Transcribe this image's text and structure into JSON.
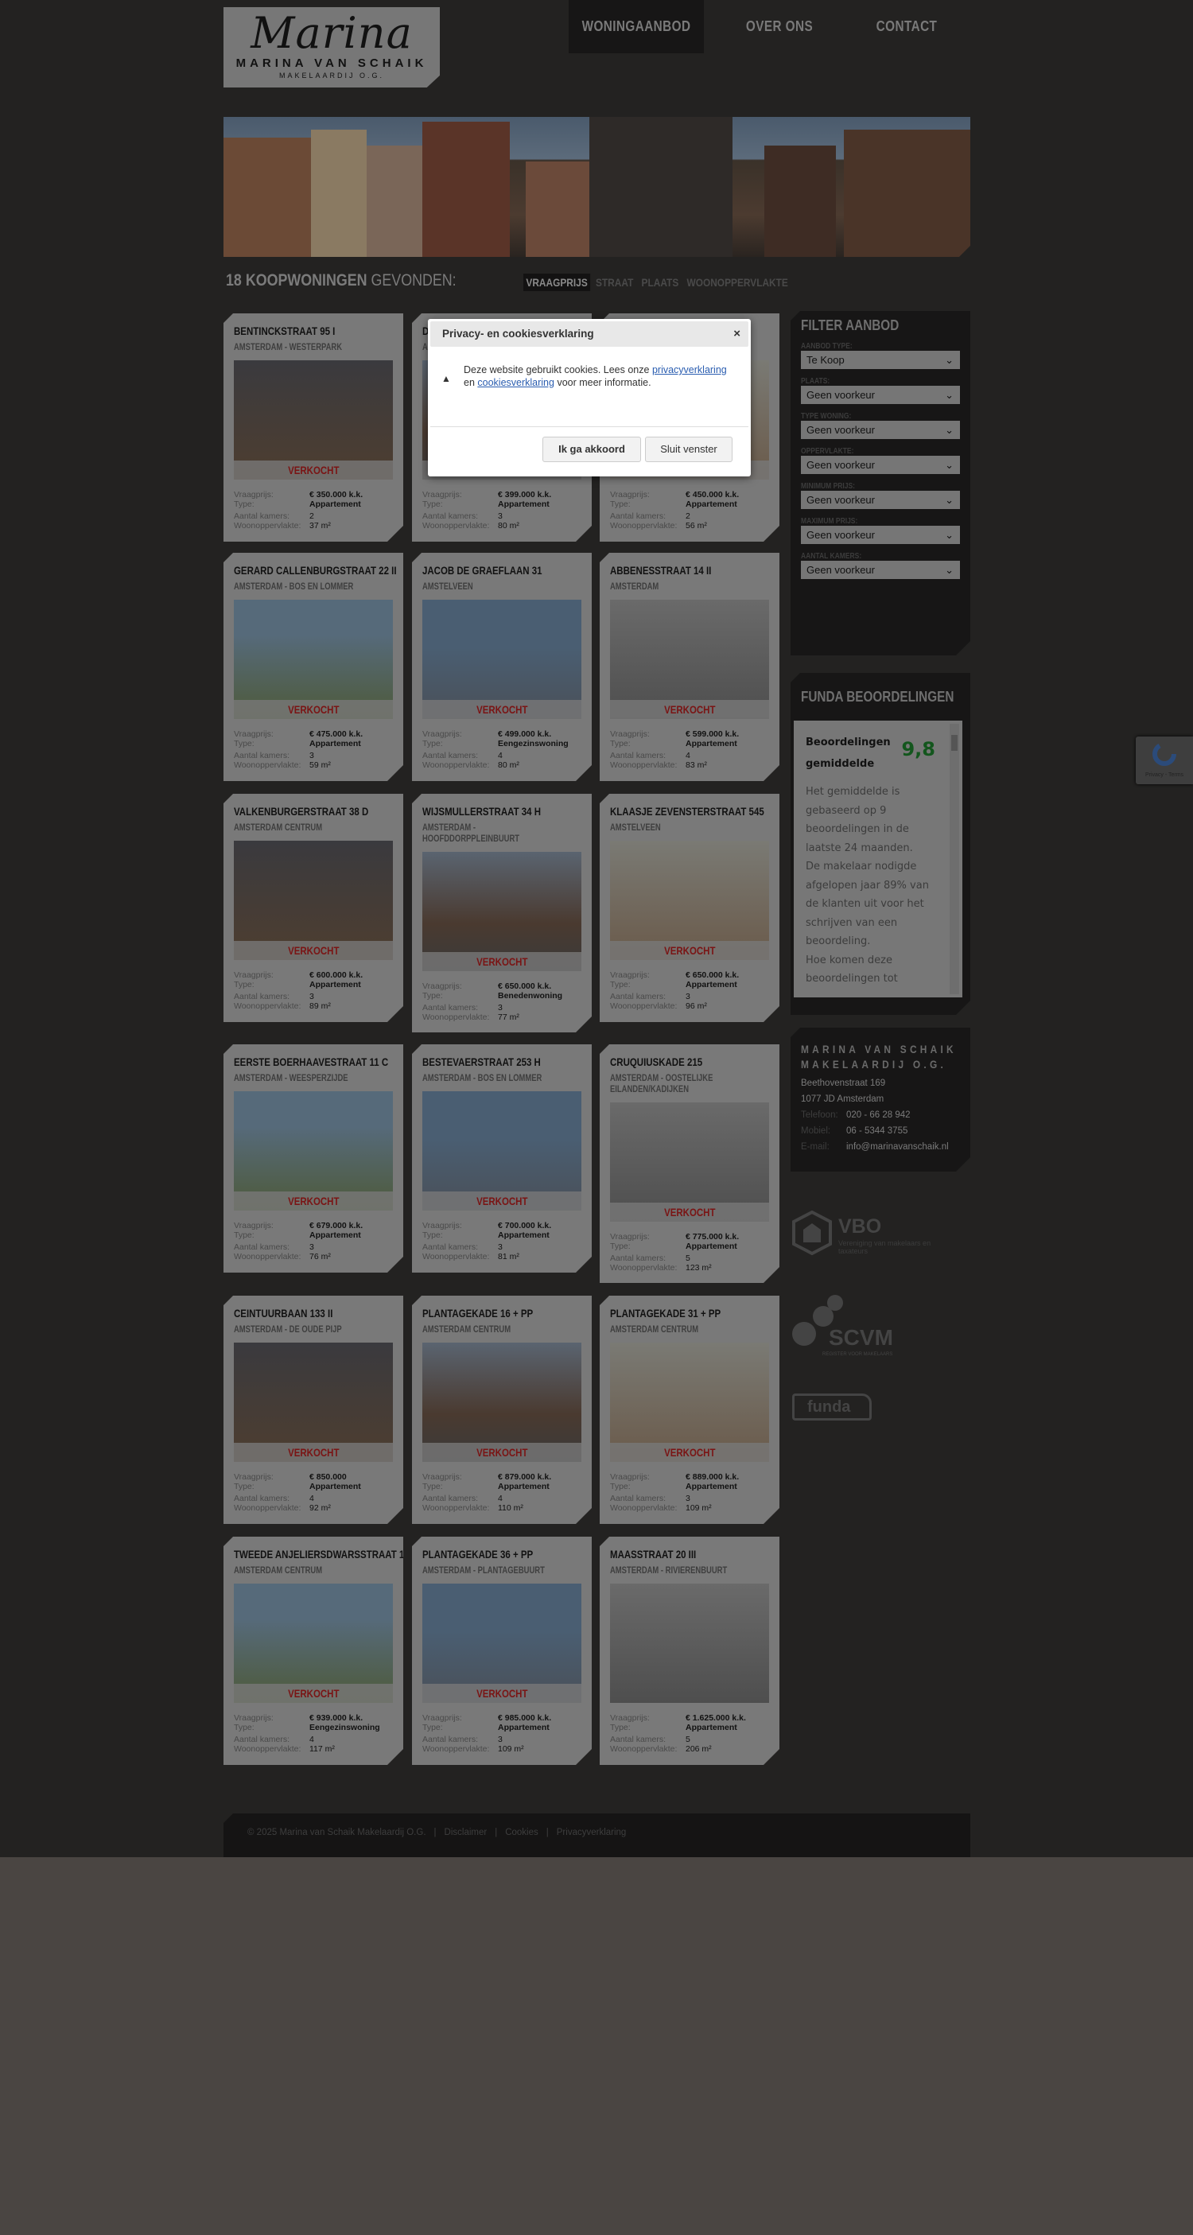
{
  "logo": {
    "script": "Marina",
    "line1": "MARINA VAN SCHAIK",
    "line2": "MAKELAARDIJ O.G."
  },
  "nav": [
    {
      "label": "WONINGAANBOD",
      "active": true
    },
    {
      "label": "OVER ONS"
    },
    {
      "label": "CONTACT"
    }
  ],
  "results": {
    "count_label": "18 KOOPWONINGEN",
    "suffix": "GEVONDEN:"
  },
  "sort": [
    {
      "label": "VRAAGPRIJS",
      "active": true
    },
    {
      "label": "STRAAT"
    },
    {
      "label": "PLAATS"
    },
    {
      "label": "WOONOPPERVLAKTE"
    }
  ],
  "labels": {
    "price": "Vraagprijs:",
    "type": "Type:",
    "rooms": "Aantal kamers:",
    "area": "Woonoppervlakte:",
    "sold": "VERKOCHT"
  },
  "listings": [
    {
      "title": "BENTINCKSTRAAT 95 I",
      "area_name": "AMSTERDAM - WESTERPARK",
      "price": "€ 350.000 k.k.",
      "type": "Appartement",
      "rooms": "2",
      "size": "37 m²",
      "sold": true
    },
    {
      "title": "D",
      "area_name": "A",
      "price": "€ 399.000 k.k.",
      "type": "Appartement",
      "rooms": "3",
      "size": "80 m²",
      "sold": true
    },
    {
      "title": "",
      "area_name": "",
      "price": "€ 450.000 k.k.",
      "type": "Appartement",
      "rooms": "2",
      "size": "56 m²",
      "sold": true
    },
    {
      "title": "GERARD CALLENBURGSTRAAT 22 II",
      "area_name": "AMSTERDAM - BOS EN LOMMER",
      "price": "€ 475.000 k.k.",
      "type": "Appartement",
      "rooms": "3",
      "size": "59 m²",
      "sold": true
    },
    {
      "title": "JACOB DE GRAEFLAAN 31",
      "area_name": "AMSTELVEEN",
      "price": "€ 499.000 k.k.",
      "type": "Eengezinswoning",
      "rooms": "4",
      "size": "80 m²",
      "sold": true
    },
    {
      "title": "ABBENESSTRAAT 14 II",
      "area_name": "AMSTERDAM",
      "price": "€ 599.000 k.k.",
      "type": "Appartement",
      "rooms": "4",
      "size": "83 m²",
      "sold": true
    },
    {
      "title": "VALKENBURGERSTRAAT 38 D",
      "area_name": "AMSTERDAM CENTRUM",
      "price": "€ 600.000 k.k.",
      "type": "Appartement",
      "rooms": "3",
      "size": "89 m²",
      "sold": true
    },
    {
      "title": "WIJSMULLERSTRAAT 34 H",
      "area_name": "AMSTERDAM - HOOFDDORPPLEINBUURT",
      "price": "€ 650.000 k.k.",
      "type": "Benedenwoning",
      "rooms": "3",
      "size": "77 m²",
      "sold": true
    },
    {
      "title": "KLAASJE ZEVENSTERSTRAAT 545",
      "area_name": "AMSTELVEEN",
      "price": "€ 650.000 k.k.",
      "type": "Appartement",
      "rooms": "3",
      "size": "96 m²",
      "sold": true
    },
    {
      "title": "EERSTE BOERHAAVESTRAAT 11 C",
      "area_name": "AMSTERDAM - WEESPERZIJDE",
      "price": "€ 679.000 k.k.",
      "type": "Appartement",
      "rooms": "3",
      "size": "76 m²",
      "sold": true
    },
    {
      "title": "BESTEVAERSTRAAT 253 H",
      "area_name": "AMSTERDAM - BOS EN LOMMER",
      "price": "€ 700.000 k.k.",
      "type": "Appartement",
      "rooms": "3",
      "size": "81 m²",
      "sold": true
    },
    {
      "title": "CRUQUIUSKADE 215",
      "area_name": "AMSTERDAM - OOSTELIJKE EILANDEN/KADIJKEN",
      "price": "€ 775.000 k.k.",
      "type": "Appartement",
      "rooms": "5",
      "size": "123 m²",
      "sold": true
    },
    {
      "title": "CEINTUURBAAN 133 II",
      "area_name": "AMSTERDAM - DE OUDE PIJP",
      "price": "€ 850.000",
      "type": "Appartement",
      "rooms": "4",
      "size": "92 m²",
      "sold": true
    },
    {
      "title": "PLANTAGEKADE 16 + PP",
      "area_name": "AMSTERDAM CENTRUM",
      "price": "€ 879.000 k.k.",
      "type": "Appartement",
      "rooms": "4",
      "size": "110 m²",
      "sold": true
    },
    {
      "title": "PLANTAGEKADE 31 + PP",
      "area_name": "AMSTERDAM CENTRUM",
      "price": "€ 889.000 k.k.",
      "type": "Appartement",
      "rooms": "3",
      "size": "109 m²",
      "sold": true
    },
    {
      "title": "TWEEDE ANJELIERSDWARSSTRAAT 11",
      "area_name": "AMSTERDAM CENTRUM",
      "price": "€ 939.000 k.k.",
      "type": "Eengezinswoning",
      "rooms": "4",
      "size": "117 m²",
      "sold": true
    },
    {
      "title": "PLANTAGEKADE 36 + PP",
      "area_name": "AMSTERDAM - PLANTAGEBUURT",
      "price": "€ 985.000 k.k.",
      "type": "Appartement",
      "rooms": "3",
      "size": "109 m²",
      "sold": true
    },
    {
      "title": "MAASSTRAAT 20 III",
      "area_name": "AMSTERDAM - RIVIERENBUURT",
      "price": "€ 1.625.000 k.k.",
      "type": "Appartement",
      "rooms": "5",
      "size": "206 m²",
      "sold": false
    }
  ],
  "filter": {
    "title": "FILTER AANBOD",
    "fields": [
      {
        "label": "AANBOD TYPE:",
        "value": "Te Koop"
      },
      {
        "label": "PLAATS:",
        "value": "Geen voorkeur"
      },
      {
        "label": "TYPE WONING:",
        "value": "Geen voorkeur"
      },
      {
        "label": "OPPERVLAKTE:",
        "value": "Geen voorkeur"
      },
      {
        "label": "MINIMUM PRIJS:",
        "value": "Geen voorkeur"
      },
      {
        "label": "MAXIMUM PRIJS:",
        "value": "Geen voorkeur"
      },
      {
        "label": "AANTAL KAMERS:",
        "value": "Geen voorkeur"
      }
    ]
  },
  "funda": {
    "title": "FUNDA BEOORDELINGEN",
    "avg_label": "Beoordelingen gemiddelde",
    "score": "9,8",
    "score_color": "#13561d",
    "text": [
      "Het gemiddelde is gebaseerd op 9 beoordelingen in de laatste 24 maanden.",
      "De makelaar nodigde afgelopen jaar 89% van de klanten uit voor het schrijven van een beoordeling.",
      "Hoe komen deze beoordelingen tot"
    ]
  },
  "contact": {
    "name1": "MARINA VAN SCHAIK",
    "name2": "MAKELAARDIJ O.G.",
    "street": "Beethovenstraat 169",
    "city": "1077 JD Amsterdam",
    "phone_label": "Telefoon:",
    "phone": "020 - 66 28 942",
    "mobile_label": "Mobiel:",
    "mobile": "06 - 5344 3755",
    "email_label": "E-mail:",
    "email": "info@marinavanschaik.nl"
  },
  "partners": {
    "vbo": "VBO",
    "vbo_sub": "Vereniging van makelaars en taxateurs",
    "scvm": "SCVM",
    "scvm_sub": "REGISTER VOOR MAKELAARS",
    "funda": "funda"
  },
  "footer": {
    "copyright": "© 2025 Marina van Schaik Makelaardij O.G.",
    "links": [
      "Disclaimer",
      "Cookies",
      "Privacyverklaring"
    ]
  },
  "modal": {
    "title": "Privacy- en cookiesverklaring",
    "close": "×",
    "text_before": "Deze website gebruikt cookies. Lees onze ",
    "link1": "privacyverklaring",
    "text_mid": " en ",
    "link2": "cookiesverklaring",
    "text_after": " voor meer informatie.",
    "accept": "Ik ga akkoord",
    "dismiss": "Sluit venster",
    "icon": "warning-icon"
  },
  "recaptcha": {
    "text": "Privacy - Terms"
  }
}
